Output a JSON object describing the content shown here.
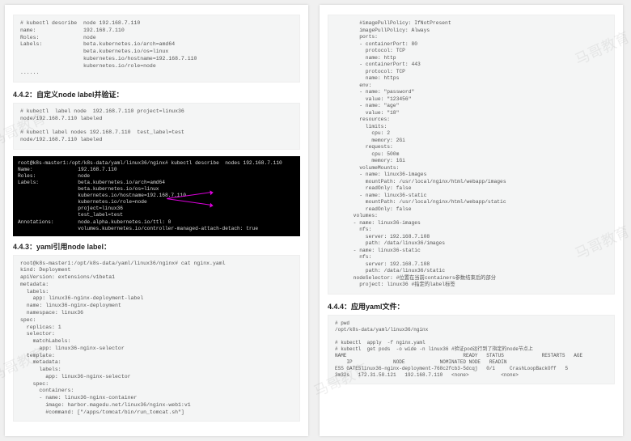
{
  "left": {
    "code1": "# kubectl describe  node 192.168.7.110\nname:               192.168.7.110\nRoles:              node\nLabels:             beta.kubernetes.io/arch=amd64\n                    beta.kubernetes.io/os=linux\n                    kubernetes.io/hostname=192.168.7.110\n                    kubernetes.io/role=node\n......",
    "h1": "4.4.2：自定义node label并验证：",
    "code2": "# kubectl  label node  192.168.7.110 project=linux36\nnode/192.168.7.110 labeled\n\n# kubectl label nodes 192.168.7.110  test_label=test\nnode/192.168.7.110 labeled",
    "term": "root@k8s-master1:/opt/k8s-data/yaml/linux36/nginx# kubectl describe  nodes 192.168.7.110\nName:               192.168.7.110\nRoles:              node\nLabels:             beta.kubernetes.io/arch=amd64\n                    beta.kubernetes.io/os=linux\n                    kubernetes.io/hostname=192.168.7.110\n                    kubernetes.io/role=node\n                    project=linux36\n                    test_label=test\nAnnotations:        node.alpha.kubernetes.io/ttl: 0\n                    volumes.kubernetes.io/controller-managed-attach-detach: true",
    "h2": "4.4.3：yaml引用node label：",
    "code3": "root@k8s-master1:/opt/k8s-data/yaml/linux36/nginx# cat nginx.yaml\nkind: Deployment\napiVersion: extensions/v1beta1\nmetadata:\n  labels:\n    app: linux36-nginx-deployment-label\n  name: linux36-nginx-deployment\n  namespace: linux36\nspec:\n  replicas: 1\n  selector:\n    matchLabels:\n      app: linux36-nginx-selector\n  template:\n    metadata:\n      labels:\n        app: linux36-nginx-selector\n    spec:\n      containers:\n      - name: linux36-nginx-container\n        image: harbor.magedu.net/linux36/nginx-web1:v1\n        #command: [\"/apps/tomcat/bin/run_tomcat.sh\"]"
  },
  "right": {
    "code1": "        #imagePullPolicy: IfNotPresent\n        imagePullPolicy: Always\n        ports:\n        - containerPort: 80\n          protocol: TCP\n          name: http\n        - containerPort: 443\n          protocol: TCP\n          name: https\n        env:\n        - name: \"password\"\n          value: \"123456\"\n        - name: \"age\"\n          value: \"18\"\n        resources:\n          limits:\n            cpu: 2\n            memory: 2Gi\n          requests:\n            cpu: 500m\n            memory: 1Gi\n        volumeMounts:\n        - name: linux36-images\n          mountPath: /usr/local/nginx/html/webapp/images\n          readOnly: false\n        - name: linux36-static\n          mountPath: /usr/local/nginx/html/webapp/static\n          readOnly: false\n      volumes:\n      - name: linux36-images\n        nfs:\n          server: 192.168.7.108\n          path: /data/linux36/images\n      - name: linux36-static\n        nfs:\n          server: 192.168.7.108\n          path: /data/linux36/static\n      nodeSelector: #位置在当前containers参数结束后的部分\n        project: linux36 #指定的label标签",
    "h1": "4.4.4：应用yaml文件：",
    "code2": "# pwd\n/opt/k8s-data/yaml/linux36/nginx\n\n# kubectl  apply  -f nginx.yaml\n# kubectl  get pods  -o wide -n linux36 #验证pod运行到了指定的node节点上\nNAME                                        READY   STATUS             RESTARTS   AGE\n    IP              NODE            NOMINATED NODE   READIN\nESS GATESlinux36-nginx-deployment-768c2fcb3-5dcqj   0/1     CrashLoopBackOff   5\n3m32s   172.31.58.121   192.168.7.110   <none>           <none>"
  },
  "watermark": "马哥教育"
}
